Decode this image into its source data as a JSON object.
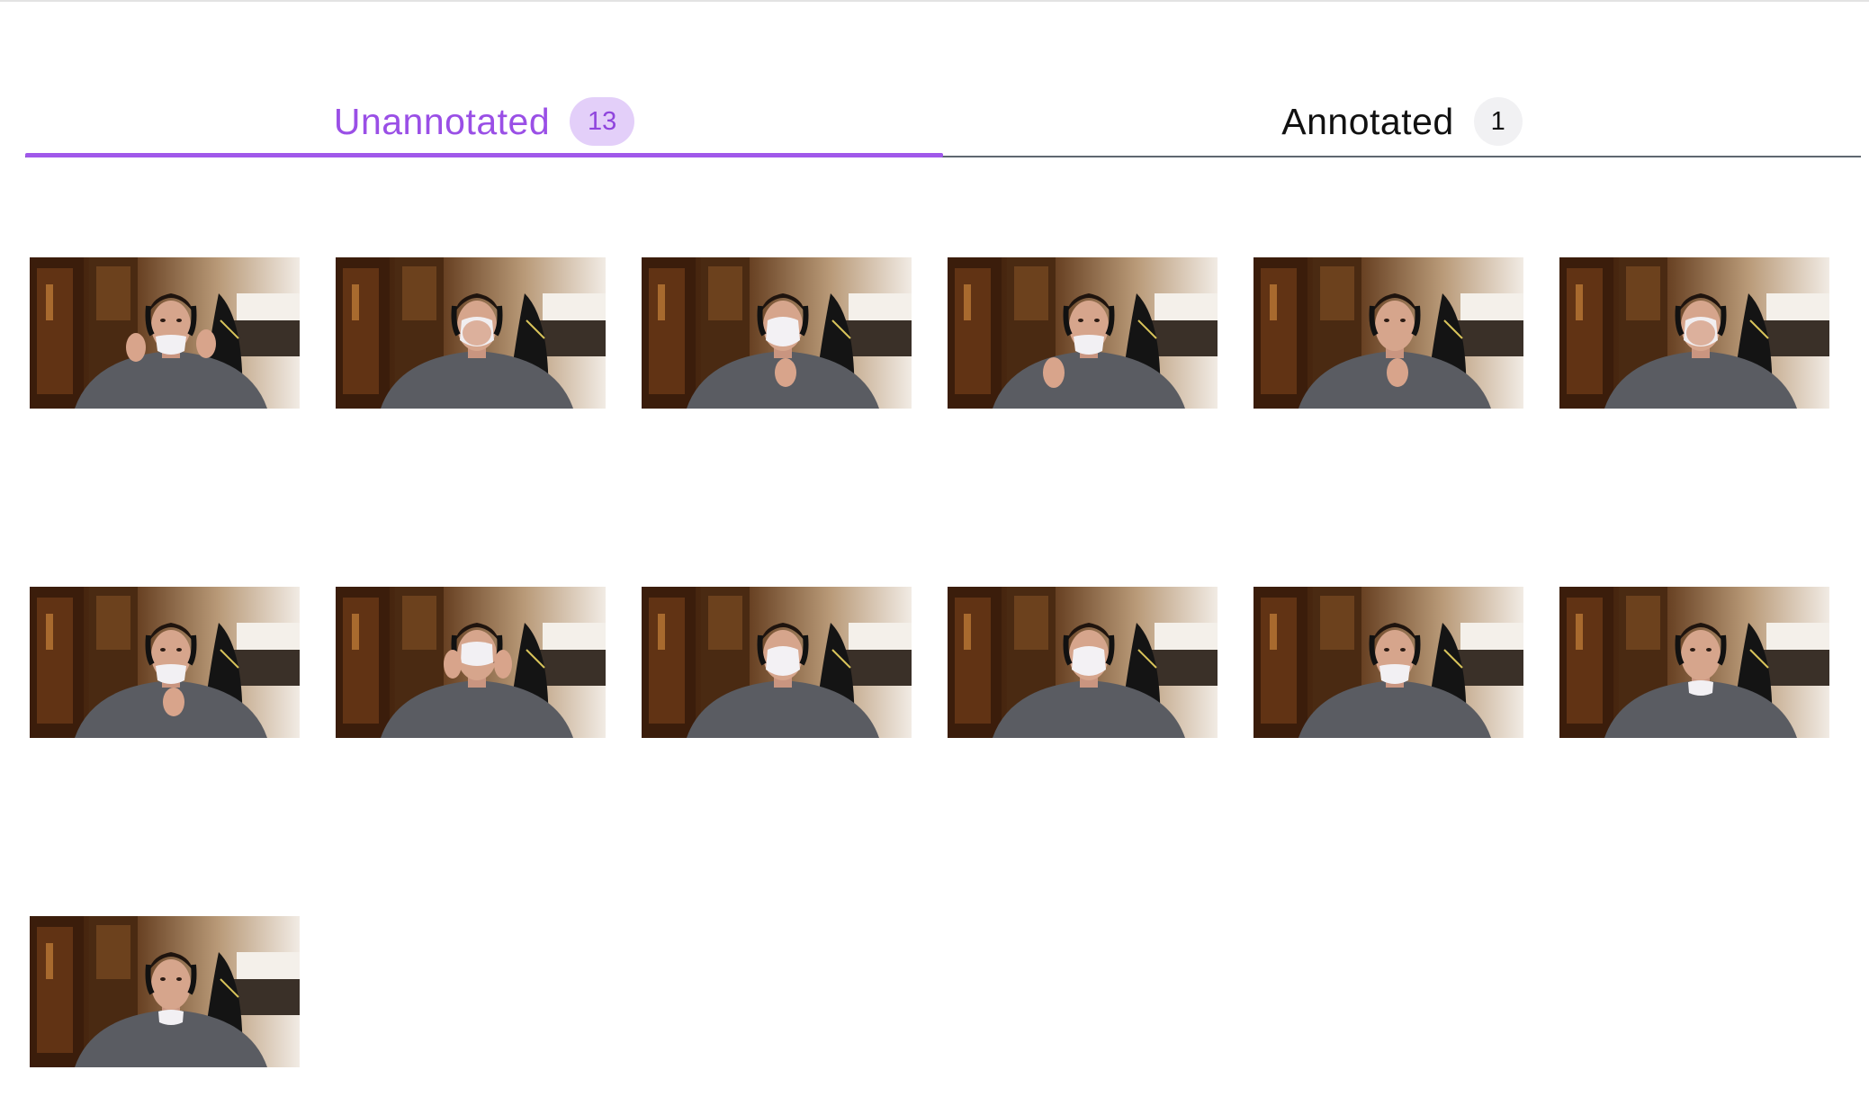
{
  "tabs": [
    {
      "label": "Unannotated",
      "count": "13",
      "active": true
    },
    {
      "label": "Annotated",
      "count": "1",
      "active": false
    }
  ],
  "colors": {
    "accent": "#a058ea",
    "accent_text": "#9a4fe6",
    "badge_active_bg": "#e3cff9",
    "badge_inactive_bg": "#f1f1f3"
  },
  "thumbnails": [
    {
      "name": "frame-1",
      "mask": "chin",
      "hand": "ear"
    },
    {
      "name": "frame-2",
      "mask": "hand-cover",
      "hand": "face"
    },
    {
      "name": "frame-3",
      "mask": "full",
      "hand": "chin"
    },
    {
      "name": "frame-4",
      "mask": "chin",
      "hand": "left"
    },
    {
      "name": "frame-5",
      "mask": "none",
      "hand": "chin"
    },
    {
      "name": "frame-6",
      "mask": "hand-cover",
      "hand": "face"
    },
    {
      "name": "frame-7",
      "mask": "chin",
      "hand": "chin"
    },
    {
      "name": "frame-8",
      "mask": "nose",
      "hand": "both"
    },
    {
      "name": "frame-9",
      "mask": "full",
      "hand": "none"
    },
    {
      "name": "frame-10",
      "mask": "full",
      "hand": "none"
    },
    {
      "name": "frame-11",
      "mask": "chin",
      "hand": "none"
    },
    {
      "name": "frame-12",
      "mask": "neck",
      "hand": "none"
    },
    {
      "name": "frame-13",
      "mask": "neck",
      "hand": "none"
    }
  ]
}
